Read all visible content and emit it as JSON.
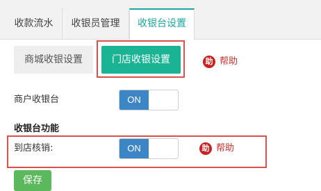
{
  "tabs": [
    {
      "label": "收款流水"
    },
    {
      "label": "收银员管理"
    },
    {
      "label": "收银台设置"
    }
  ],
  "active_tab": "收银台设置",
  "subtabs": {
    "mall_label": "商城收银设置",
    "store_label": "门店收银设置"
  },
  "help": {
    "icon_char": "助",
    "label": "帮助"
  },
  "settings": {
    "merchant_label": "商户收银台",
    "merchant_toggle": "ON",
    "functions_heading": "收银台功能",
    "store_verify_label": "到店核销:",
    "store_verify_toggle": "ON"
  },
  "save_label": "保存",
  "colors": {
    "accent": "#1ab394",
    "tab_active": "#1aa6a0",
    "toggle_on": "#3d86c6",
    "help_red": "#cc1f1f",
    "highlight": "#d9504a",
    "save": "#5cb85c"
  }
}
